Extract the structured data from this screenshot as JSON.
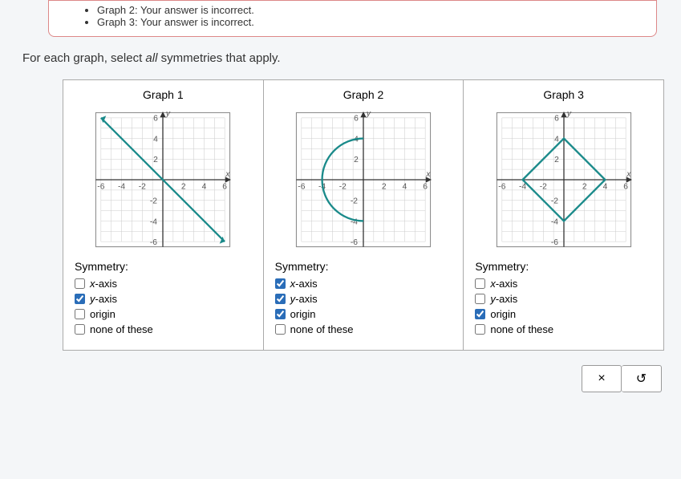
{
  "feedback": {
    "items": [
      "Graph 2: Your answer is incorrect.",
      "Graph 3: Your answer is incorrect."
    ]
  },
  "instruction": {
    "prefix": "For each graph, select ",
    "em": "all",
    "suffix": " symmetries that apply."
  },
  "graphs": [
    {
      "title": "Graph 1",
      "symlabel": "Symmetry:",
      "options": [
        {
          "label_italic": "x",
          "label_rest": "-axis",
          "checked": false
        },
        {
          "label_italic": "y",
          "label_rest": "-axis",
          "checked": true
        },
        {
          "label_italic": "",
          "label_rest": "origin",
          "checked": false
        },
        {
          "label_italic": "",
          "label_rest": "none of these",
          "checked": false
        }
      ]
    },
    {
      "title": "Graph 2",
      "symlabel": "Symmetry:",
      "options": [
        {
          "label_italic": "x",
          "label_rest": "-axis",
          "checked": true
        },
        {
          "label_italic": "y",
          "label_rest": "-axis",
          "checked": true
        },
        {
          "label_italic": "",
          "label_rest": "origin",
          "checked": true
        },
        {
          "label_italic": "",
          "label_rest": "none of these",
          "checked": false
        }
      ]
    },
    {
      "title": "Graph 3",
      "symlabel": "Symmetry:",
      "options": [
        {
          "label_italic": "x",
          "label_rest": "-axis",
          "checked": false
        },
        {
          "label_italic": "y",
          "label_rest": "-axis",
          "checked": false
        },
        {
          "label_italic": "",
          "label_rest": "origin",
          "checked": true
        },
        {
          "label_italic": "",
          "label_rest": "none of these",
          "checked": false
        }
      ]
    }
  ],
  "actions": {
    "close": "×",
    "reset": "↺"
  },
  "chart_data": [
    {
      "type": "line",
      "title": "Graph 1",
      "xlabel": "x",
      "ylabel": "y",
      "xlim": [
        -6,
        6
      ],
      "ylim": [
        -6,
        6
      ],
      "series": [
        {
          "name": "line",
          "x": [
            -6,
            6
          ],
          "y": [
            6,
            -6
          ]
        }
      ]
    },
    {
      "type": "line",
      "title": "Graph 2",
      "xlabel": "x",
      "ylabel": "y",
      "xlim": [
        -6,
        6
      ],
      "ylim": [
        -6,
        6
      ],
      "shape": "semicircle-open-right",
      "center": [
        0,
        0
      ],
      "radius": 4
    },
    {
      "type": "line",
      "title": "Graph 3",
      "xlabel": "x",
      "ylabel": "y",
      "xlim": [
        -6,
        6
      ],
      "ylim": [
        -6,
        6
      ],
      "shape": "diamond",
      "vertices": [
        [
          -4,
          0
        ],
        [
          0,
          4
        ],
        [
          4,
          0
        ],
        [
          0,
          -4
        ]
      ]
    }
  ]
}
